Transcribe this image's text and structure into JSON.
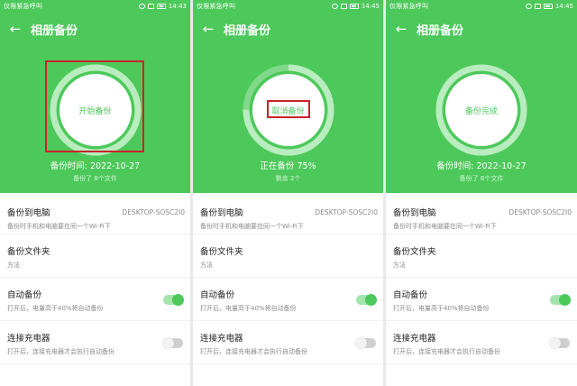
{
  "colors": {
    "brand_green": "#4cc95a",
    "annotation_red": "#c8232b"
  },
  "screens": [
    {
      "status_left": "仅限紧急呼叫",
      "time": "14:43",
      "title": "相册备份",
      "circle_label": "开始备份",
      "ring_progress": 1.0,
      "status_text": "备份时间: 2022-10-27",
      "sub_text": "备份了 8个文件",
      "highlighted": "circle",
      "settings": [
        {
          "title": "备份到电脑",
          "sub": "备份时手机和电脑要在同一个Wi-Fi下",
          "value": "DESKTOP-SOSC2I0"
        },
        {
          "title": "备份文件夹",
          "sub": "方法"
        },
        {
          "title": "自动备份",
          "sub": "打开后，电量高于40%将自动备份",
          "toggle": "on"
        },
        {
          "title": "连接充电器",
          "sub": "打开后，连接充电器才会执行自动备份",
          "toggle": "off"
        }
      ]
    },
    {
      "status_left": "仅限紧急呼叫",
      "time": "14:45",
      "title": "相册备份",
      "circle_label": "取消备份",
      "ring_progress": 0.75,
      "status_text": "正在备份 75%",
      "sub_text": "剩余 2个",
      "highlighted": "label",
      "settings": [
        {
          "title": "备份到电脑",
          "sub": "备份时手机和电脑要在同一个Wi-Fi下",
          "value": "DESKTOP-SOSC2I0"
        },
        {
          "title": "备份文件夹",
          "sub": "方法"
        },
        {
          "title": "自动备份",
          "sub": "打开后，电量高于40%将自动备份",
          "toggle": "on"
        },
        {
          "title": "连接充电器",
          "sub": "打开后，连接充电器才会执行自动备份",
          "toggle": "off"
        }
      ]
    },
    {
      "status_left": "仅限紧急呼叫",
      "time": "14:45",
      "title": "相册备份",
      "circle_label": "备份完成",
      "ring_progress": 1.0,
      "status_text": "备份时间: 2022-10-27",
      "sub_text": "备份了 8个文件",
      "highlighted": "",
      "settings": [
        {
          "title": "备份到电脑",
          "sub": "备份时手机和电脑要在同一个Wi-Fi下",
          "value": "DESKTOP-SOSC2I0"
        },
        {
          "title": "备份文件夹",
          "sub": "方法"
        },
        {
          "title": "自动备份",
          "sub": "打开后，电量高于40%将自动备份",
          "toggle": "on"
        },
        {
          "title": "连接充电器",
          "sub": "打开后，连接充电器才会执行自动备份",
          "toggle": "off"
        }
      ]
    }
  ]
}
